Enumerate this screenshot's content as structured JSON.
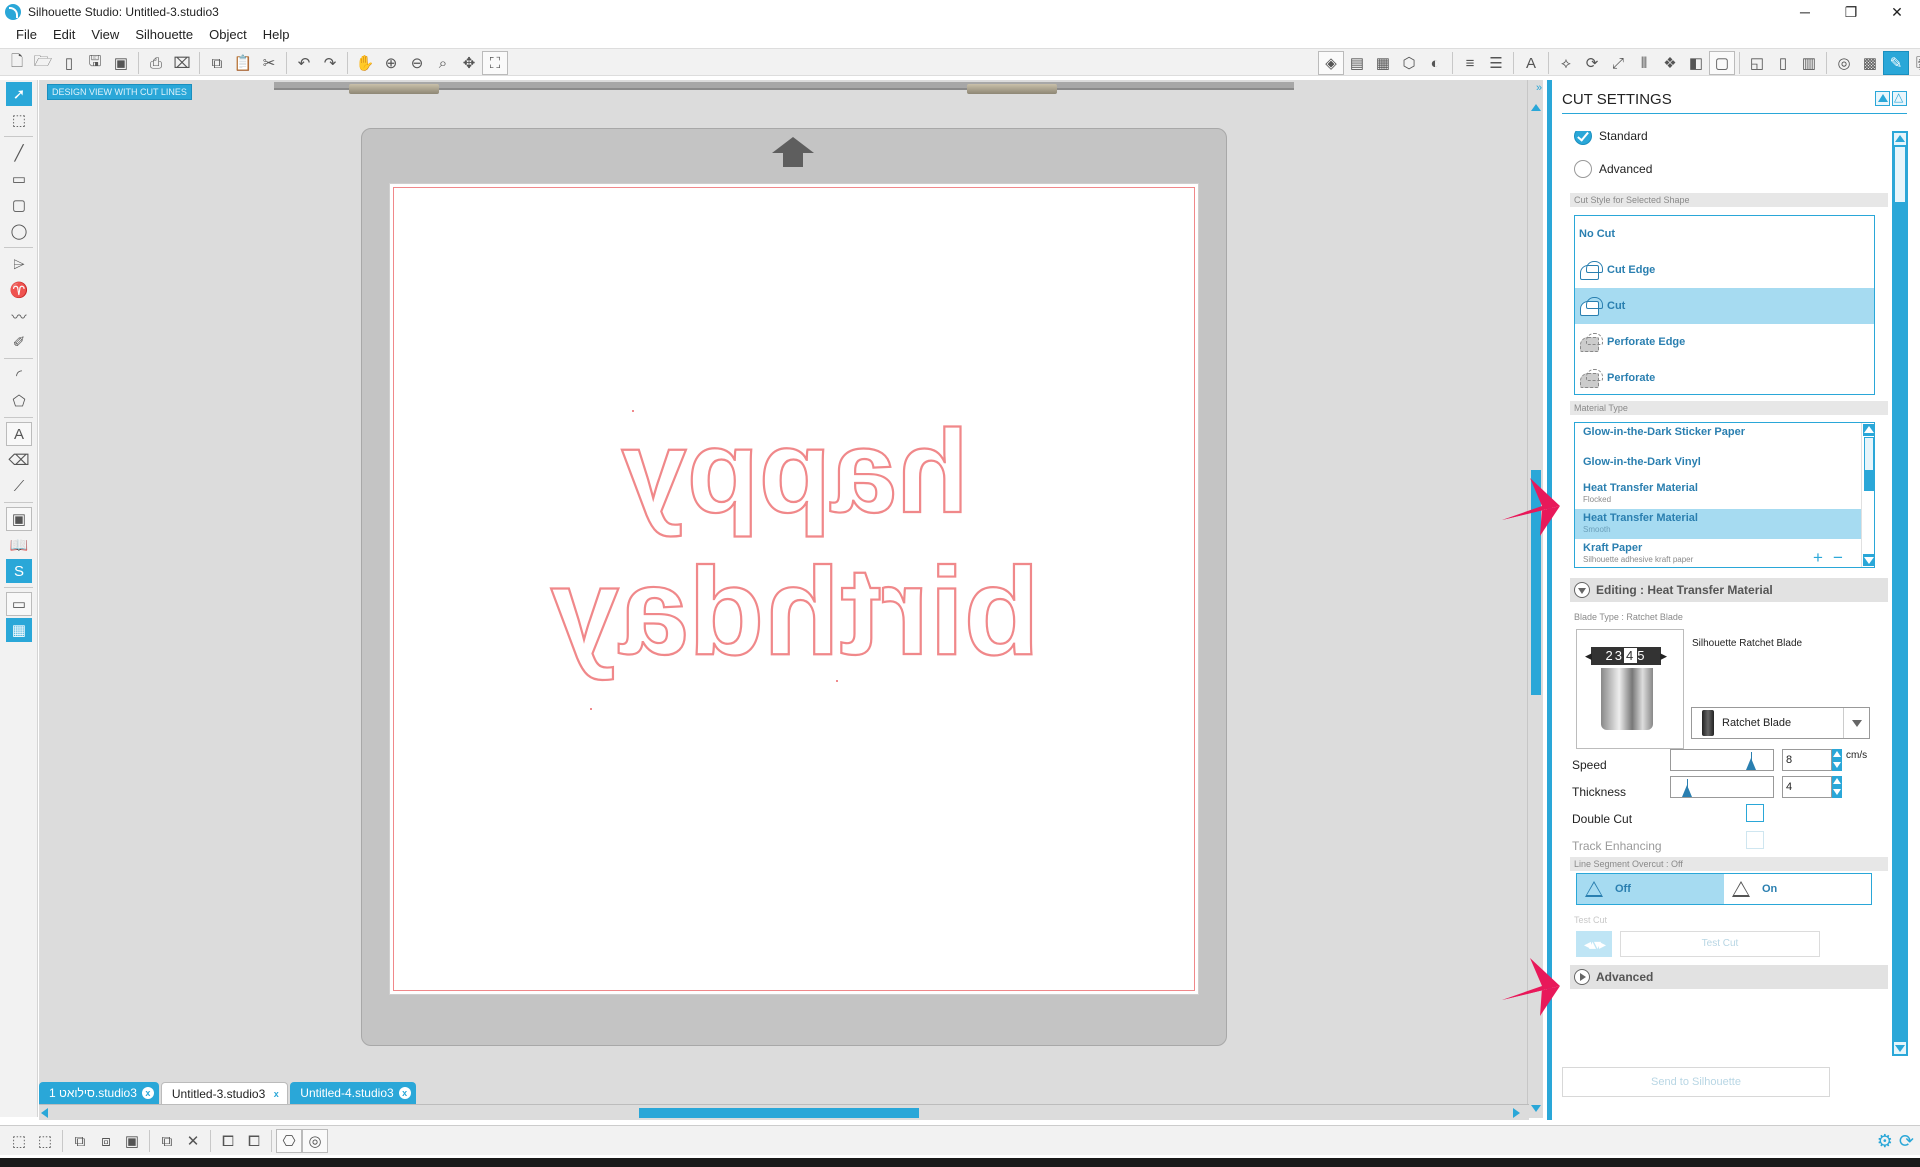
{
  "window": {
    "title": "Silhouette Studio: Untitled-3.studio3",
    "minimize": "─",
    "restore": "❐",
    "close": "✕"
  },
  "menu": [
    "File",
    "Edit",
    "View",
    "Silhouette",
    "Object",
    "Help"
  ],
  "canvas": {
    "view_label": "DESIGN VIEW WITH CUT LINES",
    "artwork_text_line1": "happy",
    "artwork_text_line2": "birthday",
    "artwork_mirrored": true,
    "cut_line_color": "#f0888a"
  },
  "document_tabs": [
    {
      "label": "סילואט 1.studio3",
      "active": false
    },
    {
      "label": "Untitled-3.studio3",
      "active": true
    },
    {
      "label": "Untitled-4.studio3",
      "active": false
    }
  ],
  "panel": {
    "title": "CUT SETTINGS",
    "mode_standard": "Standard",
    "mode_advanced": "Advanced",
    "mode_selected": "Standard",
    "cut_style_header": "Cut Style for Selected Shape",
    "cut_styles": [
      {
        "label": "No Cut",
        "icon": "none"
      },
      {
        "label": "Cut Edge",
        "icon": "cut-edge-icon"
      },
      {
        "label": "Cut",
        "icon": "cut-icon"
      },
      {
        "label": "Perforate Edge",
        "icon": "perforate-edge-icon"
      },
      {
        "label": "Perforate",
        "icon": "perforate-icon"
      }
    ],
    "cut_style_selected": "Cut",
    "material_header": "Material Type",
    "materials": [
      {
        "name": "Glow-in-the-Dark Sticker Paper",
        "sub": ""
      },
      {
        "name": "Glow-in-the-Dark Vinyl",
        "sub": ""
      },
      {
        "name": "Heat Transfer Material",
        "sub": "Flocked"
      },
      {
        "name": "Heat Transfer Material",
        "sub": "Smooth"
      },
      {
        "name": "Kraft Paper",
        "sub": "Silhouette adhesive kraft paper"
      }
    ],
    "material_selected_index": 3,
    "material_add": "+",
    "material_remove": "−",
    "editing_label": "Editing : Heat Transfer Material",
    "blade_type_header": "Blade Type : Ratchet Blade",
    "blade_name": "Silhouette Ratchet Blade",
    "blade_dial_prev": "2",
    "blade_dial_mid": "3",
    "blade_dial_current": "4",
    "blade_dial_next": "5",
    "blade_select": "Ratchet Blade",
    "speed_label": "Speed",
    "speed_value": "8",
    "speed_unit": "cm/s",
    "speed_max": 10,
    "thickness_label": "Thickness",
    "thickness_value": "4",
    "thickness_max": 33,
    "double_cut_label": "Double Cut",
    "double_cut_checked": false,
    "track_enhancing_label": "Track Enhancing",
    "track_enhancing_checked": false,
    "overcut_header": "Line Segment Overcut : Off",
    "overcut_off": "Off",
    "overcut_on": "On",
    "overcut_selected": "Off",
    "test_cut_header": "Test Cut",
    "test_cut_button": "Test Cut",
    "advanced_label": "Advanced",
    "send_button": "Send to Silhouette"
  },
  "colors": {
    "accent": "#2aa7d8",
    "selected_row": "#a6dbf1",
    "annotation_arrow": "#e8195a"
  }
}
